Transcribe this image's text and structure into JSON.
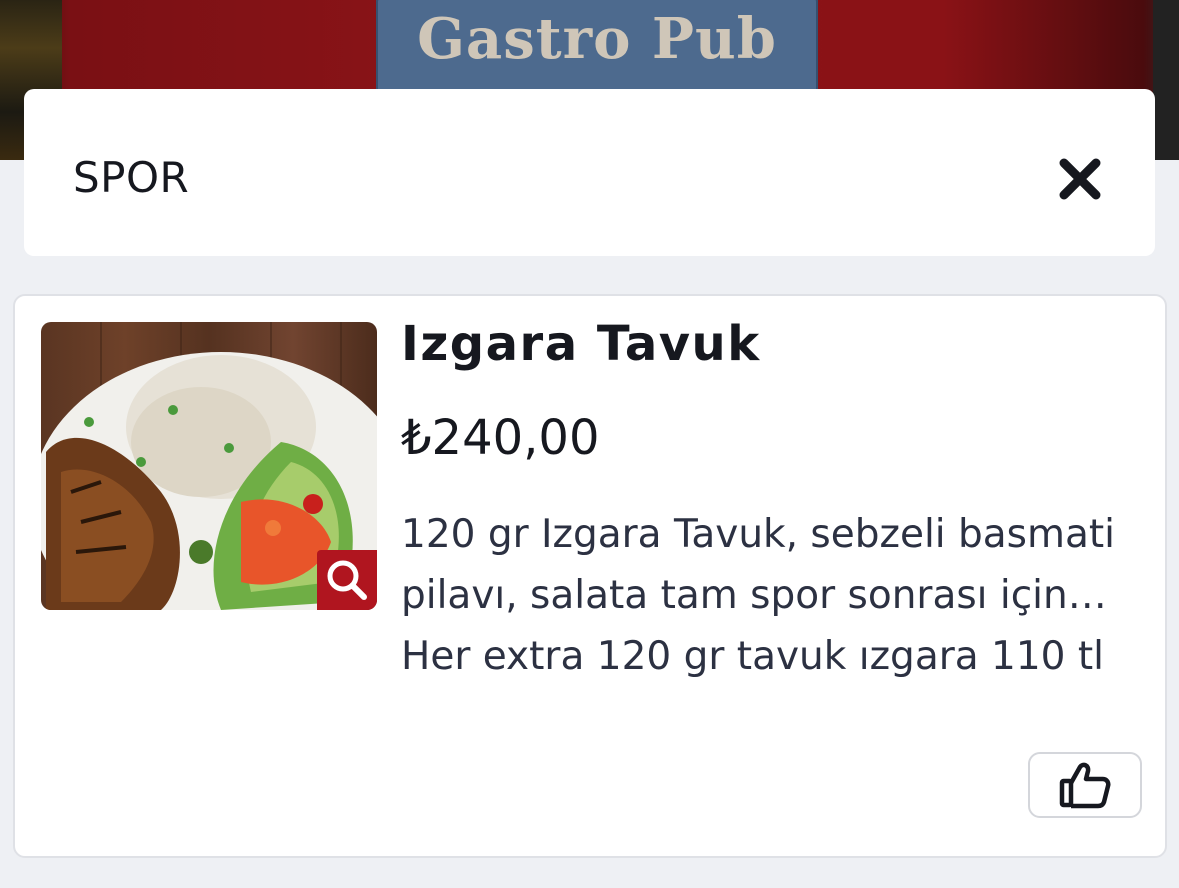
{
  "header": {
    "sign_text": "Gastro Pub"
  },
  "category": {
    "title": "SPOR",
    "close_icon": "close-icon"
  },
  "product": {
    "name": "Izgara Tavuk",
    "price": "₺240,00",
    "description": "120 gr Izgara Tavuk, sebzeli basmati pilavı, salata tam spor sonrası için… Her extra 120 gr tavuk ızgara 110 tl",
    "zoom_icon": "search-icon",
    "like_icon": "thumbs-up-icon"
  },
  "colors": {
    "accent": "#b0151f",
    "page_background": "#eef0f4",
    "card_background": "#ffffff",
    "text": "#16181f"
  }
}
